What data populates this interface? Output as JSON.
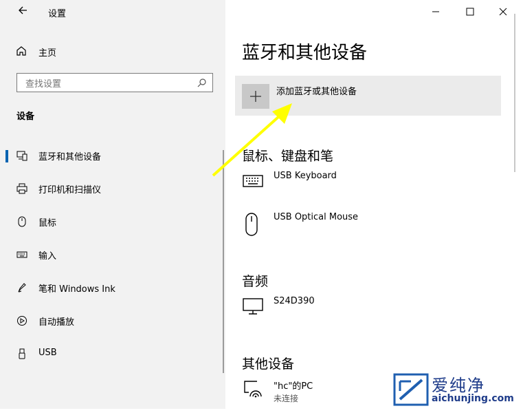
{
  "titlebar": {
    "title": "设置"
  },
  "sidebar": {
    "home_label": "主页",
    "search_placeholder": "查找设置",
    "section_title": "设备",
    "items": [
      {
        "label": "蓝牙和其他设备",
        "icon": "bluetooth-devices-icon",
        "selected": true
      },
      {
        "label": "打印机和扫描仪",
        "icon": "printer-icon",
        "selected": false
      },
      {
        "label": "鼠标",
        "icon": "mouse-icon",
        "selected": false
      },
      {
        "label": "输入",
        "icon": "keyboard-icon",
        "selected": false
      },
      {
        "label": "笔和 Windows Ink",
        "icon": "pen-icon",
        "selected": false
      },
      {
        "label": "自动播放",
        "icon": "autoplay-icon",
        "selected": false
      },
      {
        "label": "USB",
        "icon": "usb-icon",
        "selected": false
      }
    ]
  },
  "main": {
    "page_title": "蓝牙和其他设备",
    "add_label": "添加蓝牙或其他设备",
    "groups": [
      {
        "title": "鼠标、键盘和笔",
        "devices": [
          {
            "name": "USB Keyboard",
            "icon": "keyboard-icon"
          },
          {
            "name": "USB Optical Mouse",
            "icon": "mouse-icon"
          }
        ]
      },
      {
        "title": "音频",
        "devices": [
          {
            "name": "S24D390",
            "icon": "monitor-icon"
          }
        ]
      },
      {
        "title": "其他设备",
        "devices": [
          {
            "name": "\"hc\"的PC",
            "status": "未连接",
            "icon": "wireless-display-icon"
          }
        ]
      }
    ]
  },
  "watermark": {
    "brand": "爱纯净",
    "url": "aichunjing.com"
  },
  "colors": {
    "accent": "#0063b1",
    "arrow": "#ffff00",
    "sidebar_bg": "#f2f2f2"
  }
}
